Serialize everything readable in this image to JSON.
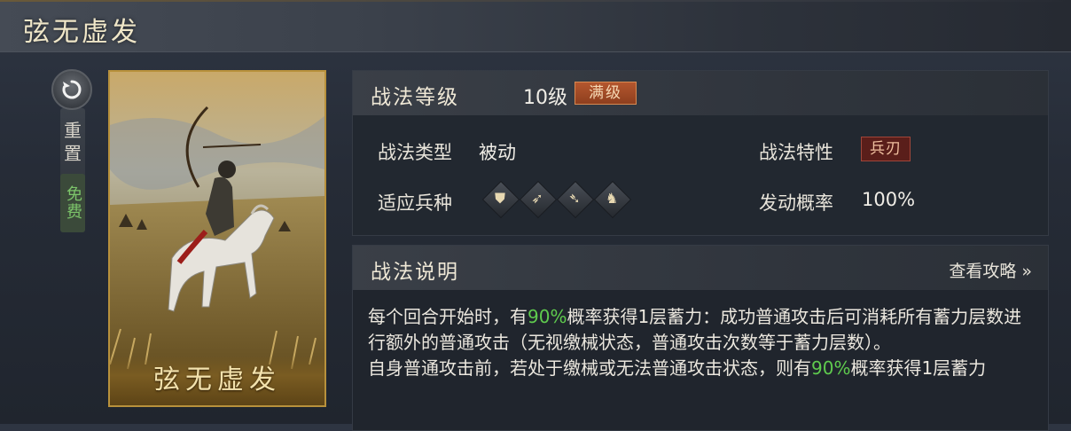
{
  "title": "弦无虚发",
  "reset": {
    "label": "重置",
    "free_label": "免费"
  },
  "card": {
    "name": "弦无虚发"
  },
  "tactic": {
    "level_label": "战法等级",
    "level_value": "10级",
    "max_badge": "满级",
    "type_label": "战法类型",
    "type_value": "被动",
    "trait_label": "战法特性",
    "trait_value": "兵刃",
    "units_label": "适应兵种",
    "units": [
      "shield-icon",
      "bow-icon",
      "spear-icon",
      "horse-icon"
    ],
    "rate_label": "发动概率",
    "rate_value": "100%"
  },
  "description": {
    "title": "战法说明",
    "guide_link": "查看攻略 »",
    "p1_a": "每个回合开始时，有",
    "p1_hl": "90%",
    "p1_b": "概率获得1层蓄力：成功普通攻击后可消耗所有蓄力层数进行额外的普通攻击（无视缴械状态，普通攻击次数等于蓄力层数）。",
    "p2_a": "自身普通攻击前，若处于缴械或无法普通攻击状态，则有",
    "p2_hl": "90%",
    "p2_b": "概率获得1层蓄力"
  },
  "colors": {
    "highlight": "#5fcb4e",
    "gold": "#b8913c",
    "max_badge": "#b4572e"
  }
}
